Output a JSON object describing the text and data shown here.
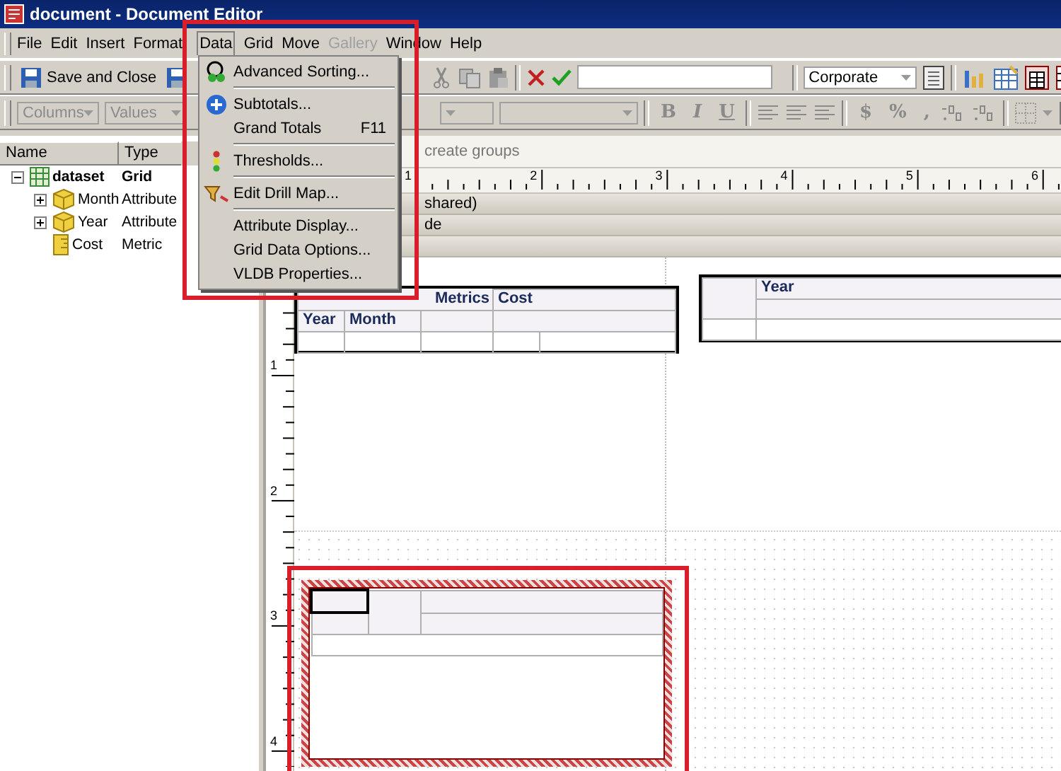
{
  "window": {
    "title": "document - Document Editor"
  },
  "menu_bar": [
    {
      "label": "File",
      "selected": false,
      "disabled": false
    },
    {
      "label": "Edit",
      "selected": false,
      "disabled": false
    },
    {
      "label": "Insert",
      "selected": false,
      "disabled": false
    },
    {
      "label": "Format",
      "selected": false,
      "disabled": false
    },
    {
      "label": "Data",
      "selected": true,
      "disabled": false
    },
    {
      "label": "Grid",
      "selected": false,
      "disabled": false
    },
    {
      "label": "Move",
      "selected": false,
      "disabled": false
    },
    {
      "label": "Gallery",
      "selected": false,
      "disabled": true
    },
    {
      "label": "Window",
      "selected": false,
      "disabled": false
    },
    {
      "label": "Help",
      "selected": false,
      "disabled": false
    }
  ],
  "toolbar": {
    "save_and_close": "Save and Close",
    "style": "Corporate"
  },
  "format_toolbar": {
    "columns": "Columns",
    "values": "Values",
    "bold": "B",
    "italic": "I",
    "underline": "U",
    "currency": "$",
    "percent": "%",
    "comma": ","
  },
  "dataset_panel": {
    "columns": [
      "Name",
      "Type"
    ],
    "tree": [
      {
        "name": "dataset",
        "type": "Grid",
        "kind": "grid",
        "expanded": true,
        "children": [
          {
            "name": "Month",
            "type": "Attribute",
            "kind": "attribute",
            "expanded": false
          },
          {
            "name": "Year",
            "type": "Attribute",
            "kind": "attribute",
            "expanded": false
          },
          {
            "name": "Cost",
            "type": "Metric",
            "kind": "metric"
          }
        ]
      }
    ]
  },
  "editor": {
    "group_hint": "create groups",
    "ruler": [
      "1",
      "2",
      "3",
      "4",
      "5",
      "6"
    ],
    "vertical_ruler": [
      "1",
      "2",
      "3",
      "4"
    ],
    "sections": [
      "shared)",
      "de"
    ],
    "grids": [
      {
        "kind": "crosstab",
        "headers": [
          "Metrics",
          "Cost"
        ],
        "rows": [
          "Year",
          "Month"
        ],
        "selected": false
      },
      {
        "kind": "columns",
        "headers": [
          "Year"
        ],
        "selected": false
      },
      {
        "kind": "empty",
        "selected": true
      }
    ]
  },
  "data_menu": [
    {
      "kind": "command",
      "label": "Advanced Sorting..."
    },
    {
      "kind": "separator"
    },
    {
      "kind": "command",
      "label": "Subtotals..."
    },
    {
      "kind": "command",
      "label": "Grand Totals",
      "shortcut": "F11"
    },
    {
      "kind": "separator"
    },
    {
      "kind": "command",
      "label": "Thresholds..."
    },
    {
      "kind": "separator"
    },
    {
      "kind": "command",
      "label": "Edit Drill Map..."
    },
    {
      "kind": "separator"
    },
    {
      "kind": "command",
      "label": "Attribute Display..."
    },
    {
      "kind": "command",
      "label": "Grid Data Options..."
    },
    {
      "kind": "command",
      "label": "VLDB Properties..."
    }
  ]
}
